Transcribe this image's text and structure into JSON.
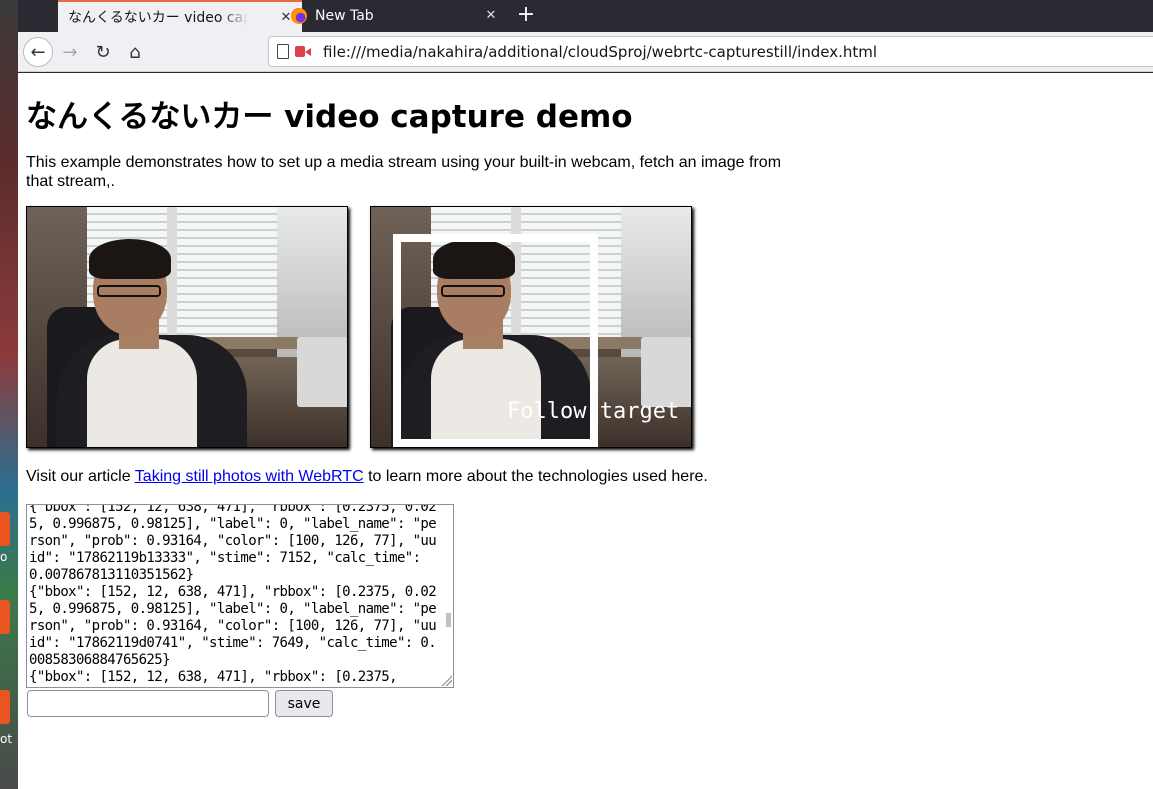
{
  "browser": {
    "tabs": [
      {
        "title": "なんくるないカー video capture demo",
        "close": "✕",
        "active": true
      },
      {
        "title": "New Tab",
        "close": "✕",
        "active": false
      }
    ],
    "new_tab": "+",
    "url": "file:///media/nakahira/additional/cloudSproj/webrtc-capturestill/index.html",
    "nav": {
      "back": "←",
      "forward": "→",
      "reload": "↻",
      "home": "⌂"
    }
  },
  "desktop": {
    "labels": [
      "o",
      "ot"
    ]
  },
  "page": {
    "title": "なんくるないカー video capture demo",
    "intro": "This example demonstrates how to set up a media stream using your built-in webcam, fetch an image from that stream,.",
    "overlay_label": "Follow target",
    "visit_prefix": "Visit our article ",
    "visit_link": "Taking still photos with WebRTC",
    "visit_suffix": " to learn more about the technologies used here.",
    "log_text": "{\"bbox\": [152, 12, 638, 471], \"rbbox\": [0.2375, 0.025, 0.996875, 0.98125], \"label\": 0, \"label_name\": \"person\", \"prob\": 0.93164, \"color\": [100, 126, 77], \"uuid\": \"17862119b13333\", \"stime\": 7152, \"calc_time\": 0.007867813110351562}\n{\"bbox\": [152, 12, 638, 471], \"rbbox\": [0.2375, 0.025, 0.996875, 0.98125], \"label\": 0, \"label_name\": \"person\", \"prob\": 0.93164, \"color\": [100, 126, 77], \"uuid\": \"17862119d0741\", \"stime\": 7649, \"calc_time\": 0.00858306884765625}\n{\"bbox\": [152, 12, 638, 471], \"rbbox\": [0.2375,",
    "name_input_value": "",
    "save_label": "save"
  }
}
